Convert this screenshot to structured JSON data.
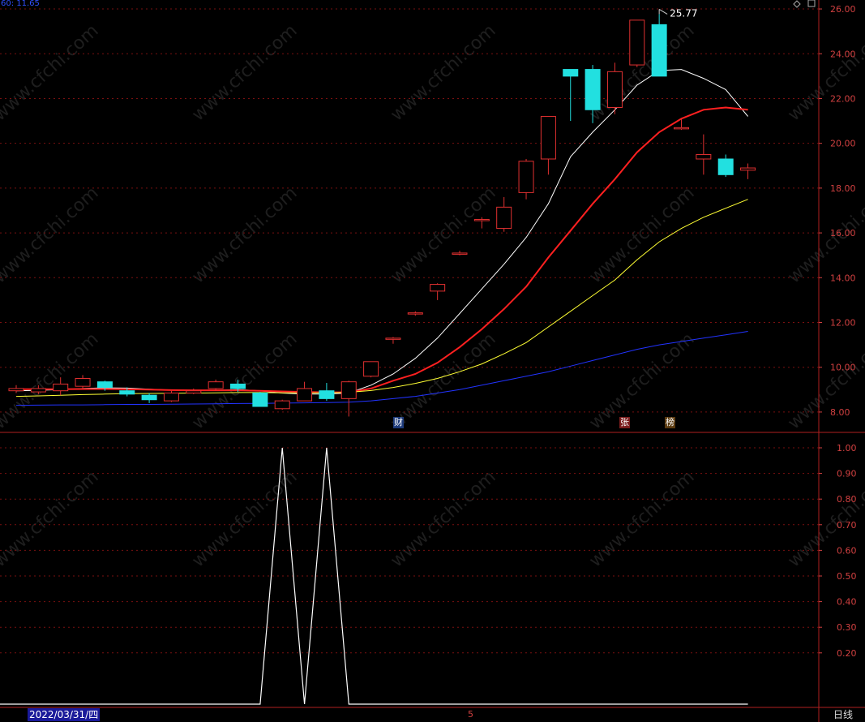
{
  "header": {
    "info_text": "60: 11.65"
  },
  "status_bar": {
    "date": "2022/03/31/四",
    "mark": "5",
    "period": "日线"
  },
  "watermark": "www.cfchi.com",
  "badges": {
    "cai": "财",
    "zhang": "张",
    "bang": "榜"
  },
  "colors": {
    "up": "#e03030",
    "down": "#22e0e0",
    "ma1": "#ffffff",
    "ma2": "#ff2020",
    "ma3": "#ffff33",
    "ma4": "#2233ff",
    "grid": "#7a1010",
    "axis": "#d04040",
    "indicator": "#ffffff"
  },
  "chart_data": [
    {
      "type": "candlestick",
      "ylim": [
        7.2,
        26.4
      ],
      "y_ticks": [
        "8.00",
        "10.00",
        "12.00",
        "14.00",
        "16.00",
        "18.00",
        "20.00",
        "22.00",
        "24.00",
        "26.00"
      ],
      "max_label": "25.77",
      "candles": [
        {
          "o": 8.95,
          "c": 9.05,
          "h": 9.2,
          "l": 8.85
        },
        {
          "o": 8.9,
          "c": 9.05,
          "h": 9.2,
          "l": 8.8
        },
        {
          "o": 8.95,
          "c": 9.25,
          "h": 9.55,
          "l": 8.75
        },
        {
          "o": 9.15,
          "c": 9.5,
          "h": 9.65,
          "l": 9.05
        },
        {
          "o": 9.35,
          "c": 9.1,
          "h": 9.4,
          "l": 8.95
        },
        {
          "o": 8.95,
          "c": 8.8,
          "h": 9.1,
          "l": 8.7
        },
        {
          "o": 8.75,
          "c": 8.55,
          "h": 8.85,
          "l": 8.4
        },
        {
          "o": 8.5,
          "c": 8.85,
          "h": 8.95,
          "l": 8.45
        },
        {
          "o": 8.85,
          "c": 8.95,
          "h": 9.05,
          "l": 8.8
        },
        {
          "o": 9.05,
          "c": 9.35,
          "h": 9.45,
          "l": 8.95
        },
        {
          "o": 9.25,
          "c": 9.05,
          "h": 9.45,
          "l": 8.9
        },
        {
          "o": 8.85,
          "c": 8.25,
          "h": 8.9,
          "l": 8.25
        },
        {
          "o": 8.15,
          "c": 8.5,
          "h": 8.55,
          "l": 8.1
        },
        {
          "o": 8.5,
          "c": 9.05,
          "h": 9.35,
          "l": 8.5
        },
        {
          "o": 8.95,
          "c": 8.6,
          "h": 9.3,
          "l": 8.5
        },
        {
          "o": 8.6,
          "c": 9.35,
          "h": 9.4,
          "l": 7.8
        },
        {
          "o": 9.6,
          "c": 10.25,
          "h": 10.25,
          "l": 9.55
        },
        {
          "o": 11.3,
          "c": 11.3,
          "h": 11.35,
          "l": 11.05
        },
        {
          "o": 12.43,
          "c": 12.43,
          "h": 12.5,
          "l": 12.3
        },
        {
          "o": 13.4,
          "c": 13.7,
          "h": 13.75,
          "l": 13.0
        },
        {
          "o": 15.1,
          "c": 15.1,
          "h": 15.2,
          "l": 15.0
        },
        {
          "o": 16.6,
          "c": 16.6,
          "h": 16.7,
          "l": 16.2
        },
        {
          "o": 16.2,
          "c": 17.15,
          "h": 17.6,
          "l": 16.05
        },
        {
          "o": 17.8,
          "c": 19.2,
          "h": 19.3,
          "l": 17.5
        },
        {
          "o": 19.3,
          "c": 21.2,
          "h": 21.2,
          "l": 18.6
        },
        {
          "o": 23.3,
          "c": 23.0,
          "h": 23.3,
          "l": 21.0
        },
        {
          "o": 23.3,
          "c": 21.5,
          "h": 23.5,
          "l": 20.9
        },
        {
          "o": 21.6,
          "c": 23.2,
          "h": 23.6,
          "l": 21.3
        },
        {
          "o": 23.5,
          "c": 25.5,
          "h": 25.5,
          "l": 23.4
        },
        {
          "o": 25.3,
          "c": 23.0,
          "h": 25.77,
          "l": 23.0
        },
        {
          "o": 20.7,
          "c": 20.7,
          "h": 21.1,
          "l": 20.6
        },
        {
          "o": 19.3,
          "c": 19.5,
          "h": 20.4,
          "l": 18.6
        },
        {
          "o": 19.3,
          "c": 18.6,
          "h": 19.5,
          "l": 18.5
        },
        {
          "o": 18.8,
          "c": 18.9,
          "h": 19.1,
          "l": 18.4
        }
      ],
      "ma_lines": [
        {
          "color_key": "ma1",
          "values": [
            8.95,
            8.97,
            9.0,
            9.05,
            9.08,
            9.07,
            9.02,
            8.98,
            8.95,
            8.97,
            9.0,
            8.95,
            8.85,
            8.8,
            8.8,
            8.85,
            9.2,
            9.7,
            10.4,
            11.3,
            12.4,
            13.5,
            14.6,
            15.8,
            17.3,
            19.4,
            20.5,
            21.5,
            22.6,
            23.25,
            23.3,
            22.9,
            22.4,
            21.2
          ]
        },
        {
          "color_key": "ma2",
          "values": [
            9.02,
            9.02,
            9.02,
            9.03,
            9.03,
            9.02,
            9.0,
            8.98,
            8.97,
            8.97,
            8.97,
            8.95,
            8.92,
            8.9,
            8.88,
            8.88,
            9.05,
            9.4,
            9.7,
            10.2,
            10.9,
            11.7,
            12.6,
            13.6,
            14.9,
            16.1,
            17.3,
            18.4,
            19.6,
            20.5,
            21.1,
            21.5,
            21.6,
            21.5
          ]
        },
        {
          "color_key": "ma3",
          "values": [
            8.7,
            8.72,
            8.75,
            8.78,
            8.8,
            8.82,
            8.83,
            8.84,
            8.85,
            8.86,
            8.87,
            8.87,
            8.86,
            8.86,
            8.86,
            8.88,
            8.96,
            9.1,
            9.28,
            9.5,
            9.8,
            10.15,
            10.6,
            11.1,
            11.8,
            12.5,
            13.2,
            13.9,
            14.8,
            15.6,
            16.2,
            16.7,
            17.1,
            17.5
          ]
        },
        {
          "color_key": "ma4",
          "values": [
            8.3,
            8.31,
            8.32,
            8.32,
            8.33,
            8.34,
            8.34,
            8.35,
            8.36,
            8.37,
            8.38,
            8.39,
            8.4,
            8.41,
            8.42,
            8.44,
            8.5,
            8.6,
            8.7,
            8.85,
            9.0,
            9.2,
            9.4,
            9.6,
            9.8,
            10.05,
            10.3,
            10.55,
            10.8,
            11.0,
            11.15,
            11.3,
            11.45,
            11.6
          ]
        }
      ]
    },
    {
      "type": "line",
      "ylim": [
        0,
        1.05
      ],
      "y_ticks": [
        "1.00",
        "0.90",
        "0.80",
        "0.70",
        "0.60",
        "0.50",
        "0.40",
        "0.30",
        "0.20"
      ],
      "values": [
        0,
        0,
        0,
        0,
        0,
        0,
        0,
        0,
        0,
        0,
        0,
        0,
        1,
        0,
        1,
        0,
        0,
        0,
        0,
        0,
        0,
        0,
        0,
        0,
        0,
        0,
        0,
        0,
        0,
        0,
        0,
        0,
        0,
        0
      ]
    }
  ]
}
